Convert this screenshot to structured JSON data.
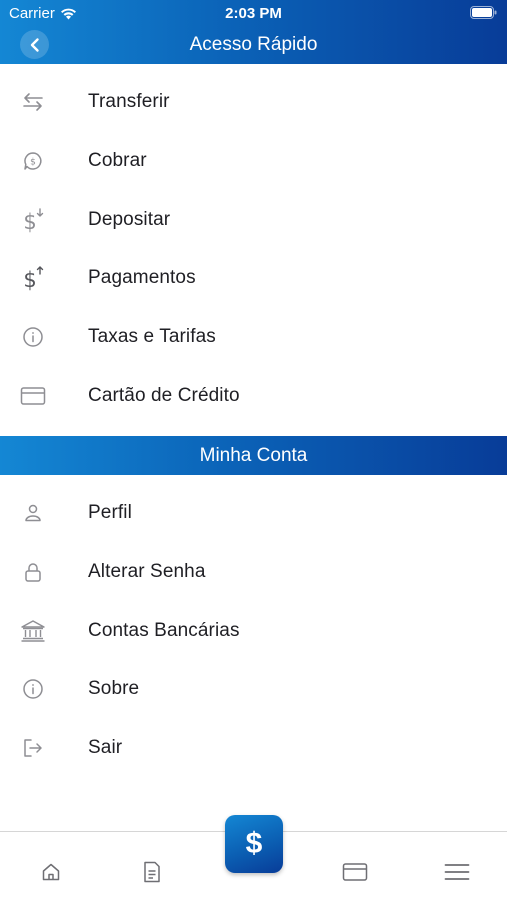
{
  "status": {
    "carrier": "Carrier",
    "time": "2:03 PM"
  },
  "header": {
    "title": "Acesso Rápido"
  },
  "quick_access": [
    {
      "label": "Transferir",
      "icon": "transfer-arrows-icon"
    },
    {
      "label": "Cobrar",
      "icon": "charge-chat-icon"
    },
    {
      "label": "Depositar",
      "icon": "deposit-dollar-icon"
    },
    {
      "label": "Pagamentos",
      "icon": "payment-dollar-icon"
    },
    {
      "label": "Taxas e Tarifas",
      "icon": "info-icon"
    },
    {
      "label": "Cartão de Crédito",
      "icon": "credit-card-icon"
    }
  ],
  "account_section": {
    "title": "Minha Conta"
  },
  "account": [
    {
      "label": "Perfil",
      "icon": "person-icon"
    },
    {
      "label": "Alterar Senha",
      "icon": "lock-icon"
    },
    {
      "label": "Contas Bancárias",
      "icon": "bank-icon"
    },
    {
      "label": "Sobre",
      "icon": "info-icon"
    },
    {
      "label": "Sair",
      "icon": "logout-icon"
    }
  ],
  "tab_bar": {
    "center_symbol": "$",
    "tabs": [
      "home-icon",
      "document-icon",
      "card-icon",
      "menu-icon"
    ]
  },
  "colors": {
    "brand_start": "#1487d4",
    "brand_end": "#083c98",
    "icon_gray": "#8e8e93"
  }
}
